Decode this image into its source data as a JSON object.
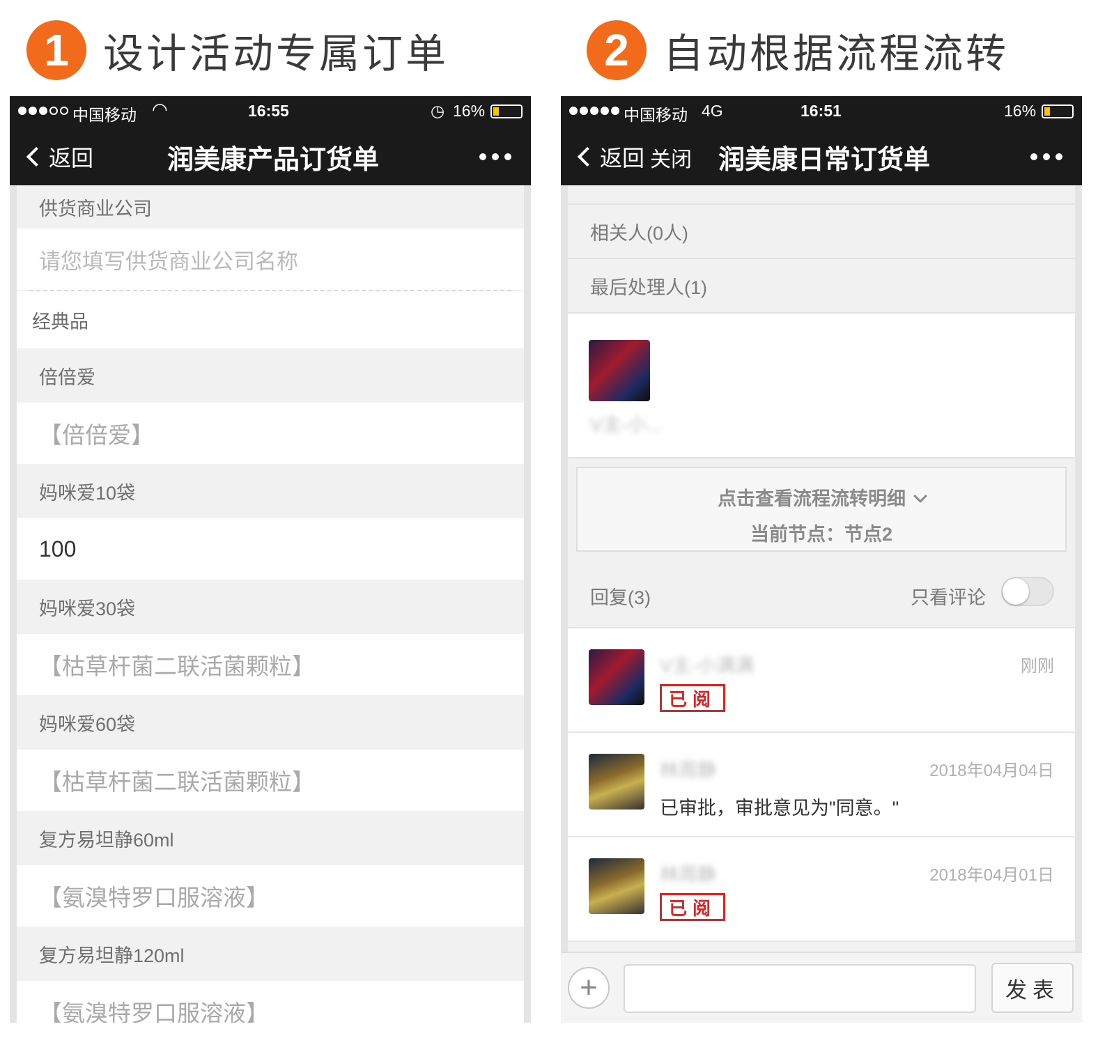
{
  "steps": [
    {
      "num": "1",
      "text": "设计活动专属订单"
    },
    {
      "num": "2",
      "text": "自动根据流程流转"
    }
  ],
  "left_phone": {
    "status": {
      "carrier": "中国移动",
      "time": "16:55",
      "battery": "16%"
    },
    "nav": {
      "back": "返回",
      "title": "润美康产品订货单"
    },
    "supplier": {
      "label": "供货商业公司",
      "placeholder": "请您填写供货商业公司名称"
    },
    "section": "经典品",
    "products": [
      {
        "label": "倍倍爱",
        "value": "【倍倍爱】"
      },
      {
        "label": "妈咪爱10袋",
        "value": "100"
      },
      {
        "label": "妈咪爱30袋",
        "value": "【枯草杆菌二联活菌颗粒】"
      },
      {
        "label": "妈咪爱60袋",
        "value": "【枯草杆菌二联活菌颗粒】"
      },
      {
        "label": "复方易坦静60ml",
        "value": "【氨溴特罗口服溶液】"
      },
      {
        "label": "复方易坦静120ml",
        "value": "【氨溴特罗口服溶液】"
      }
    ]
  },
  "right_phone": {
    "status": {
      "carrier": "中国移动",
      "network": "4G",
      "time": "16:51",
      "battery": "16%"
    },
    "nav": {
      "back": "返回",
      "close": "关闭",
      "title": "润美康日常订货单"
    },
    "related": "相关人(0人)",
    "last_handler": "最后处理人(1)",
    "handler_name": "V主-小...",
    "flow": {
      "link": "点击查看流程流转明细",
      "current": "当前节点：节点2"
    },
    "replies": {
      "label": "回复(3)",
      "only_comments": "只看评论"
    },
    "comments": [
      {
        "name": "V主-小满满",
        "time": "刚刚",
        "stamp": "已阅",
        "text": ""
      },
      {
        "name": "林周静",
        "time": "2018年04月04日",
        "stamp": "",
        "text": "已审批，审批意见为\"同意。\""
      },
      {
        "name": "林周静",
        "time": "2018年04月01日",
        "stamp": "已阅",
        "text": ""
      }
    ],
    "send_label": "发表"
  }
}
